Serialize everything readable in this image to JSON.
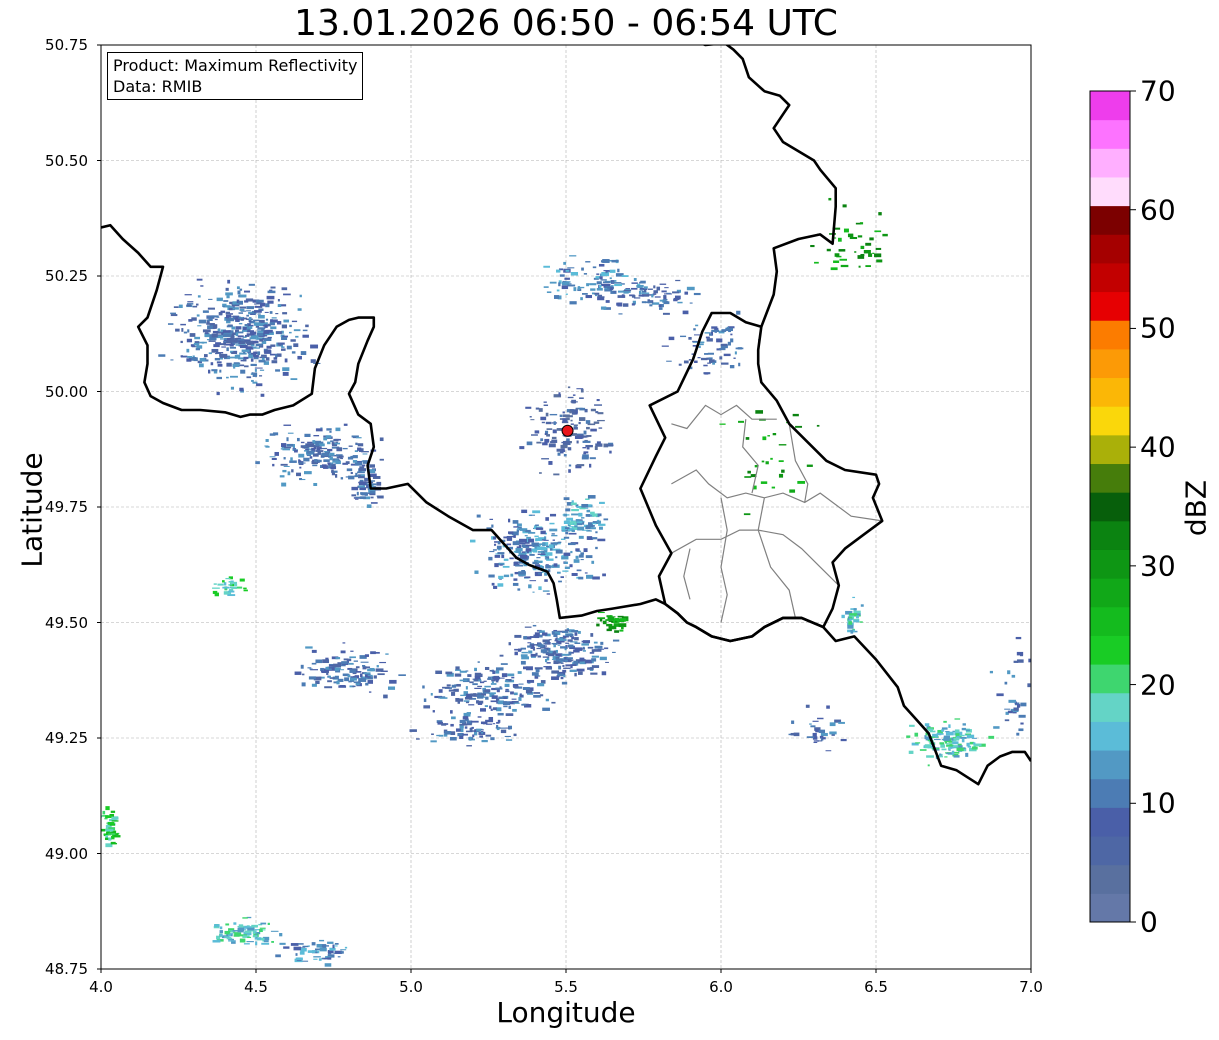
{
  "title": "13.01.2026 06:50 - 06:54 UTC",
  "info_box": {
    "line1": "Product: Maximum Reflectivity",
    "line2": "Data: RMIB"
  },
  "axes": {
    "xlabel": "Longitude",
    "ylabel": "Latitude",
    "xlim": [
      4.0,
      7.0
    ],
    "ylim": [
      48.75,
      50.75
    ],
    "xticks": [
      "4.0",
      "4.5",
      "5.0",
      "5.5",
      "6.0",
      "6.5",
      "7.0"
    ],
    "yticks": [
      "50.75",
      "50.50",
      "50.25",
      "50.00",
      "49.75",
      "49.50",
      "49.25",
      "49.00",
      "48.75"
    ],
    "grid": true
  },
  "radar_site": {
    "lon": 5.505,
    "lat": 49.915,
    "color": "#e8161b"
  },
  "colorbar": {
    "label": "dBZ",
    "range": [
      0,
      70
    ],
    "ticks": [
      "0",
      "10",
      "20",
      "30",
      "40",
      "50",
      "60",
      "70"
    ],
    "colors": [
      "#6478a8",
      "#59709f",
      "#4e67a5",
      "#4a5fa8",
      "#4c7cb4",
      "#5299c4",
      "#5bbcd8",
      "#64d4c6",
      "#3ed66f",
      "#19cc25",
      "#14bb1e",
      "#11a818",
      "#0e9614",
      "#0b8311",
      "#075f0b",
      "#467d0b",
      "#aab009",
      "#fad70b",
      "#fbb706",
      "#fc9a06",
      "#fc7c00",
      "#e60002",
      "#c20000",
      "#a50000",
      "#7c0000",
      "#ffdcfc",
      "#ffafff",
      "#fd73ff",
      "#ee3dec"
    ]
  },
  "colors": {
    "border_country": "#000000",
    "border_region": "#808080",
    "echo_base": "#4f6aa5"
  },
  "country_border": [
    [
      4.0,
      50.355
    ],
    [
      4.03,
      50.36
    ],
    [
      4.07,
      50.33
    ],
    [
      4.12,
      50.3
    ],
    [
      4.16,
      50.27
    ],
    [
      4.2,
      50.27
    ],
    [
      4.18,
      50.22
    ],
    [
      4.15,
      50.16
    ],
    [
      4.12,
      50.14
    ],
    [
      4.15,
      50.1
    ],
    [
      4.15,
      50.06
    ],
    [
      4.14,
      50.02
    ],
    [
      4.16,
      49.99
    ],
    [
      4.2,
      49.975
    ],
    [
      4.26,
      49.96
    ],
    [
      4.32,
      49.96
    ],
    [
      4.4,
      49.955
    ],
    [
      4.45,
      49.945
    ],
    [
      4.48,
      49.95
    ],
    [
      4.52,
      49.95
    ],
    [
      4.56,
      49.96
    ],
    [
      4.62,
      49.97
    ],
    [
      4.68,
      49.995
    ],
    [
      4.69,
      50.05
    ],
    [
      4.72,
      50.1
    ],
    [
      4.76,
      50.14
    ],
    [
      4.8,
      50.155
    ],
    [
      4.83,
      50.16
    ],
    [
      4.88,
      50.16
    ],
    [
      4.88,
      50.14
    ],
    [
      4.86,
      50.11
    ],
    [
      4.83,
      50.06
    ],
    [
      4.82,
      50.02
    ],
    [
      4.8,
      49.995
    ],
    [
      4.83,
      49.95
    ],
    [
      4.87,
      49.93
    ],
    [
      4.88,
      49.88
    ],
    [
      4.86,
      49.84
    ],
    [
      4.87,
      49.79
    ],
    [
      4.92,
      49.79
    ],
    [
      4.99,
      49.8
    ],
    [
      5.05,
      49.76
    ],
    [
      5.12,
      49.73
    ],
    [
      5.2,
      49.7
    ],
    [
      5.26,
      49.7
    ],
    [
      5.3,
      49.67
    ],
    [
      5.34,
      49.64
    ],
    [
      5.38,
      49.625
    ],
    [
      5.42,
      49.615
    ],
    [
      5.44,
      49.61
    ],
    [
      5.46,
      49.585
    ],
    [
      5.47,
      49.55
    ],
    [
      5.48,
      49.51
    ],
    [
      5.55,
      49.515
    ],
    [
      5.6,
      49.525
    ],
    [
      5.65,
      49.53
    ],
    [
      5.74,
      49.54
    ],
    [
      5.79,
      49.55
    ],
    [
      5.82,
      49.54
    ],
    [
      5.86,
      49.52
    ],
    [
      5.89,
      49.5
    ],
    [
      5.92,
      49.49
    ],
    [
      5.97,
      49.47
    ],
    [
      6.03,
      49.46
    ],
    [
      6.1,
      49.47
    ],
    [
      6.14,
      49.49
    ],
    [
      6.2,
      49.51
    ],
    [
      6.26,
      49.51
    ],
    [
      6.33,
      49.49
    ],
    [
      6.37,
      49.46
    ],
    [
      6.43,
      49.47
    ],
    [
      6.5,
      49.42
    ],
    [
      6.57,
      49.36
    ],
    [
      6.59,
      49.32
    ],
    [
      6.63,
      49.29
    ],
    [
      6.67,
      49.26
    ],
    [
      6.71,
      49.19
    ],
    [
      6.76,
      49.18
    ],
    [
      6.83,
      49.15
    ],
    [
      6.86,
      49.19
    ],
    [
      6.9,
      49.21
    ],
    [
      6.94,
      49.22
    ],
    [
      6.98,
      49.22
    ],
    [
      7.0,
      49.2
    ]
  ],
  "lux_border": [
    [
      5.82,
      49.54
    ],
    [
      5.8,
      49.6
    ],
    [
      5.84,
      49.65
    ],
    [
      5.79,
      49.71
    ],
    [
      5.74,
      49.79
    ],
    [
      5.79,
      49.86
    ],
    [
      5.82,
      49.9
    ],
    [
      5.77,
      49.97
    ],
    [
      5.86,
      50.0
    ],
    [
      5.91,
      50.07
    ],
    [
      5.94,
      50.13
    ],
    [
      5.97,
      50.17
    ],
    [
      6.03,
      50.17
    ],
    [
      6.08,
      50.15
    ],
    [
      6.13,
      50.14
    ],
    [
      6.12,
      50.09
    ],
    [
      6.12,
      50.06
    ],
    [
      6.13,
      50.02
    ],
    [
      6.18,
      49.98
    ],
    [
      6.22,
      49.93
    ],
    [
      6.28,
      49.89
    ],
    [
      6.34,
      49.85
    ],
    [
      6.4,
      49.83
    ],
    [
      6.5,
      49.82
    ],
    [
      6.51,
      49.8
    ],
    [
      6.49,
      49.77
    ],
    [
      6.52,
      49.72
    ],
    [
      6.46,
      49.69
    ],
    [
      6.4,
      49.66
    ],
    [
      6.36,
      49.63
    ],
    [
      6.38,
      49.58
    ],
    [
      6.36,
      49.53
    ],
    [
      6.33,
      49.49
    ],
    [
      6.26,
      49.51
    ],
    [
      6.2,
      49.51
    ],
    [
      6.14,
      49.49
    ],
    [
      6.1,
      49.47
    ],
    [
      6.03,
      49.46
    ],
    [
      5.97,
      49.47
    ],
    [
      5.92,
      49.49
    ],
    [
      5.89,
      49.5
    ],
    [
      5.86,
      49.52
    ],
    [
      5.82,
      49.54
    ]
  ],
  "de_border": [
    [
      6.13,
      50.14
    ],
    [
      6.17,
      50.21
    ],
    [
      6.18,
      50.26
    ],
    [
      6.17,
      50.31
    ],
    [
      6.25,
      50.33
    ],
    [
      6.32,
      50.34
    ],
    [
      6.36,
      50.32
    ],
    [
      6.37,
      50.4
    ],
    [
      6.37,
      50.44
    ],
    [
      6.32,
      50.48
    ],
    [
      6.3,
      50.5
    ],
    [
      6.25,
      50.52
    ],
    [
      6.2,
      50.54
    ],
    [
      6.17,
      50.57
    ],
    [
      6.2,
      50.6
    ],
    [
      6.22,
      50.62
    ],
    [
      6.19,
      50.64
    ],
    [
      6.14,
      50.65
    ],
    [
      6.09,
      50.68
    ],
    [
      6.07,
      50.72
    ],
    [
      6.04,
      50.74
    ],
    [
      6.01,
      50.755
    ]
  ],
  "nl_border": [
    [
      5.87,
      50.755
    ],
    [
      5.91,
      50.76
    ],
    [
      5.95,
      50.75
    ],
    [
      5.98,
      50.752
    ],
    [
      6.02,
      50.755
    ]
  ],
  "region_lines": [
    [
      [
        5.84,
        49.93
      ],
      [
        5.89,
        49.92
      ],
      [
        5.95,
        49.97
      ],
      [
        6.0,
        49.95
      ],
      [
        6.05,
        49.97
      ],
      [
        6.1,
        49.94
      ],
      [
        6.18,
        49.94
      ]
    ],
    [
      [
        5.84,
        49.8
      ],
      [
        5.92,
        49.83
      ],
      [
        5.96,
        49.8
      ],
      [
        6.02,
        49.77
      ],
      [
        6.08,
        49.78
      ],
      [
        6.14,
        49.77
      ],
      [
        6.2,
        49.78
      ],
      [
        6.27,
        49.76
      ],
      [
        6.32,
        49.78
      ],
      [
        6.42,
        49.73
      ],
      [
        6.52,
        49.72
      ]
    ],
    [
      [
        5.84,
        49.65
      ],
      [
        5.92,
        49.68
      ],
      [
        6.0,
        49.68
      ],
      [
        6.06,
        49.7
      ],
      [
        6.12,
        49.7
      ],
      [
        6.2,
        49.69
      ],
      [
        6.26,
        49.66
      ],
      [
        6.32,
        49.62
      ],
      [
        6.38,
        49.58
      ]
    ],
    [
      [
        6.0,
        49.77
      ],
      [
        6.02,
        49.7
      ],
      [
        6.0,
        49.62
      ],
      [
        6.02,
        49.56
      ],
      [
        6.0,
        49.5
      ]
    ],
    [
      [
        6.14,
        49.77
      ],
      [
        6.12,
        49.7
      ],
      [
        6.16,
        49.62
      ],
      [
        6.22,
        49.57
      ],
      [
        6.24,
        49.51
      ]
    ],
    [
      [
        6.08,
        49.94
      ],
      [
        6.07,
        49.88
      ],
      [
        6.12,
        49.84
      ],
      [
        6.1,
        49.78
      ]
    ],
    [
      [
        5.9,
        49.66
      ],
      [
        5.88,
        49.6
      ],
      [
        5.9,
        49.55
      ]
    ],
    [
      [
        6.22,
        49.93
      ],
      [
        6.24,
        49.85
      ],
      [
        6.28,
        49.8
      ],
      [
        6.27,
        49.76
      ]
    ]
  ],
  "echo_clusters": [
    {
      "lon": 4.45,
      "lat": 50.12,
      "w": 0.35,
      "h": 0.18,
      "n": 420,
      "lvl": 4
    },
    {
      "lon": 4.7,
      "lat": 49.87,
      "w": 0.3,
      "h": 0.1,
      "n": 180,
      "lvl": 4
    },
    {
      "lon": 4.85,
      "lat": 49.8,
      "w": 0.08,
      "h": 0.08,
      "n": 60,
      "lvl": 4
    },
    {
      "lon": 5.4,
      "lat": 49.65,
      "w": 0.32,
      "h": 0.14,
      "n": 260,
      "lvl": 5
    },
    {
      "lon": 5.48,
      "lat": 49.44,
      "w": 0.26,
      "h": 0.1,
      "n": 200,
      "lvl": 4
    },
    {
      "lon": 5.25,
      "lat": 49.36,
      "w": 0.35,
      "h": 0.1,
      "n": 170,
      "lvl": 4
    },
    {
      "lon": 4.78,
      "lat": 49.4,
      "w": 0.25,
      "h": 0.08,
      "n": 120,
      "lvl": 4
    },
    {
      "lon": 5.18,
      "lat": 49.27,
      "w": 0.25,
      "h": 0.06,
      "n": 80,
      "lvl": 4
    },
    {
      "lon": 5.58,
      "lat": 50.24,
      "w": 0.3,
      "h": 0.08,
      "n": 90,
      "lvl": 5
    },
    {
      "lon": 5.75,
      "lat": 50.21,
      "w": 0.3,
      "h": 0.06,
      "n": 80,
      "lvl": 4
    },
    {
      "lon": 5.95,
      "lat": 50.1,
      "w": 0.22,
      "h": 0.12,
      "n": 70,
      "lvl": 4
    },
    {
      "lon": 5.5,
      "lat": 49.92,
      "w": 0.22,
      "h": 0.16,
      "n": 140,
      "lvl": 3
    },
    {
      "lon": 5.55,
      "lat": 49.73,
      "w": 0.14,
      "h": 0.08,
      "n": 70,
      "lvl": 6
    },
    {
      "lon": 6.72,
      "lat": 49.24,
      "w": 0.2,
      "h": 0.08,
      "n": 120,
      "lvl": 7
    },
    {
      "lon": 6.42,
      "lat": 49.51,
      "w": 0.05,
      "h": 0.07,
      "n": 30,
      "lvl": 7
    },
    {
      "lon": 4.45,
      "lat": 48.83,
      "w": 0.2,
      "h": 0.05,
      "n": 80,
      "lvl": 7
    },
    {
      "lon": 4.7,
      "lat": 48.79,
      "w": 0.2,
      "h": 0.04,
      "n": 50,
      "lvl": 5
    },
    {
      "lon": 4.02,
      "lat": 49.06,
      "w": 0.05,
      "h": 0.08,
      "n": 40,
      "lvl": 9
    },
    {
      "lon": 4.42,
      "lat": 49.58,
      "w": 0.12,
      "h": 0.04,
      "n": 30,
      "lvl": 8
    },
    {
      "lon": 6.42,
      "lat": 50.32,
      "w": 0.2,
      "h": 0.15,
      "n": 40,
      "lvl": 12
    },
    {
      "lon": 6.15,
      "lat": 49.88,
      "w": 0.25,
      "h": 0.25,
      "n": 30,
      "lvl": 12
    },
    {
      "lon": 5.65,
      "lat": 49.5,
      "w": 0.1,
      "h": 0.05,
      "n": 30,
      "lvl": 12
    },
    {
      "lon": 6.95,
      "lat": 49.35,
      "w": 0.12,
      "h": 0.2,
      "n": 30,
      "lvl": 4
    },
    {
      "lon": 6.3,
      "lat": 49.28,
      "w": 0.15,
      "h": 0.1,
      "n": 30,
      "lvl": 4
    }
  ]
}
